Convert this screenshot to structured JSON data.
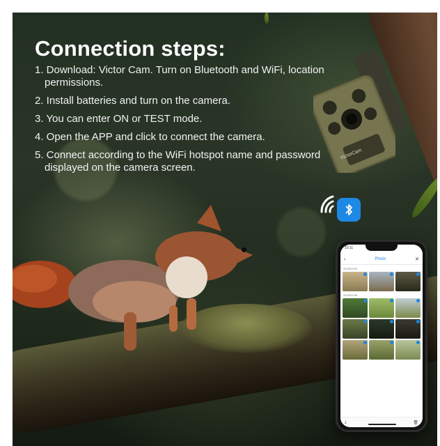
{
  "title": "Connection steps:",
  "steps": [
    "1. Download: Victor Cam. Turn on Bluetooth and WiFi, location permissions.",
    "2. Install batteries and turn on the camera.",
    "3. You can enter ON or TEST mode.",
    "4. Open the APP and click to connect the camera.",
    "5. Connect according to the WiFi hotspot name and password displayed on the camera screen."
  ],
  "camera": {
    "brand": "VictorCam"
  },
  "phone": {
    "status_time": "10:11",
    "header_title": "Photo",
    "back_icon": "chevron-left-icon",
    "close_icon": "close-icon",
    "date_1": "2023/07/09",
    "date_2": "2023/07/08",
    "bottom_left_icon": "download-icon",
    "bottom_right_icon": "trash-icon"
  },
  "icons": {
    "wifi": "wifi-icon",
    "bluetooth": "bluetooth-icon"
  },
  "colors": {
    "accent": "#1e88e5",
    "text": "#ffffff"
  }
}
